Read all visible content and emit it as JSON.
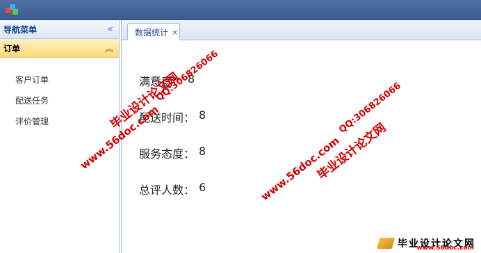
{
  "sidebar": {
    "title": "导航菜单",
    "section": "订单",
    "items": [
      {
        "label": "客户订单"
      },
      {
        "label": "配送任务"
      },
      {
        "label": "评价管理"
      }
    ]
  },
  "tabs": [
    {
      "label": "数据统计",
      "close": "×"
    }
  ],
  "stats": [
    {
      "label": "满意度",
      "sep": "：",
      "value": "8"
    },
    {
      "label": "配送时间",
      "sep": "：",
      "value": "8"
    },
    {
      "label": "服务态度",
      "sep": "：",
      "value": "8"
    },
    {
      "label": "总评人数",
      "sep": "：",
      "value": "6"
    }
  ],
  "watermarks": {
    "site_name": "毕业设计论文网",
    "url": "www.56doc.com",
    "qq": "QQ:306826066",
    "logo_url": "www.56doc.com"
  },
  "icons": {
    "app_logo": "cube-logo-icon",
    "collapse": "double-chevron-left-icon",
    "accordion": "double-chevron-up-icon",
    "tab_close": "close-icon"
  },
  "colors": {
    "header_bg": "#3a5c92",
    "accordion_active": "#ffd878",
    "watermark": "#d40000"
  }
}
